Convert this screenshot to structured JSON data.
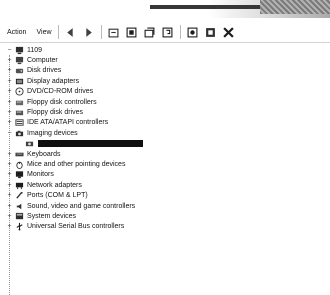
{
  "menubar": {
    "action_label": "Action",
    "view_label": "View"
  },
  "toolbar": {
    "buttons": [
      "back-icon",
      "forward-icon",
      "up-icon",
      "properties-icon",
      "refresh-icon",
      "help-icon",
      "scan-icon",
      "uninstall-icon",
      "disable-icon"
    ]
  },
  "tree": {
    "root": {
      "label": "1109",
      "icon": "computer-icon"
    },
    "items": [
      {
        "label": "Computer",
        "icon": "computer-icon",
        "expander": "+"
      },
      {
        "label": "Disk drives",
        "icon": "disk-icon",
        "expander": "+"
      },
      {
        "label": "Display adapters",
        "icon": "display-icon",
        "expander": "+"
      },
      {
        "label": "DVD/CD-ROM drives",
        "icon": "dvd-icon",
        "expander": "+"
      },
      {
        "label": "Floppy disk controllers",
        "icon": "floppy-icon",
        "expander": "+"
      },
      {
        "label": "Floppy disk drives",
        "icon": "floppy-icon",
        "expander": "+"
      },
      {
        "label": "IDE ATA/ATAPI controllers",
        "icon": "ide-icon",
        "expander": "+"
      },
      {
        "label": "Imaging devices",
        "icon": "camera-icon",
        "expander": "−"
      },
      {
        "label": "Keyboards",
        "icon": "keyboard-icon",
        "expander": "+"
      },
      {
        "label": "Mice and other pointing devices",
        "icon": "mouse-icon",
        "expander": "+"
      },
      {
        "label": "Monitors",
        "icon": "monitor-icon",
        "expander": "+"
      },
      {
        "label": "Network adapters",
        "icon": "network-icon",
        "expander": "+"
      },
      {
        "label": "Ports (COM & LPT)",
        "icon": "port-icon",
        "expander": "+"
      },
      {
        "label": "Sound, video and game controllers",
        "icon": "sound-icon",
        "expander": "+"
      },
      {
        "label": "System devices",
        "icon": "system-icon",
        "expander": "+"
      },
      {
        "label": "Universal Serial Bus controllers",
        "icon": "usb-icon",
        "expander": "+"
      }
    ]
  }
}
